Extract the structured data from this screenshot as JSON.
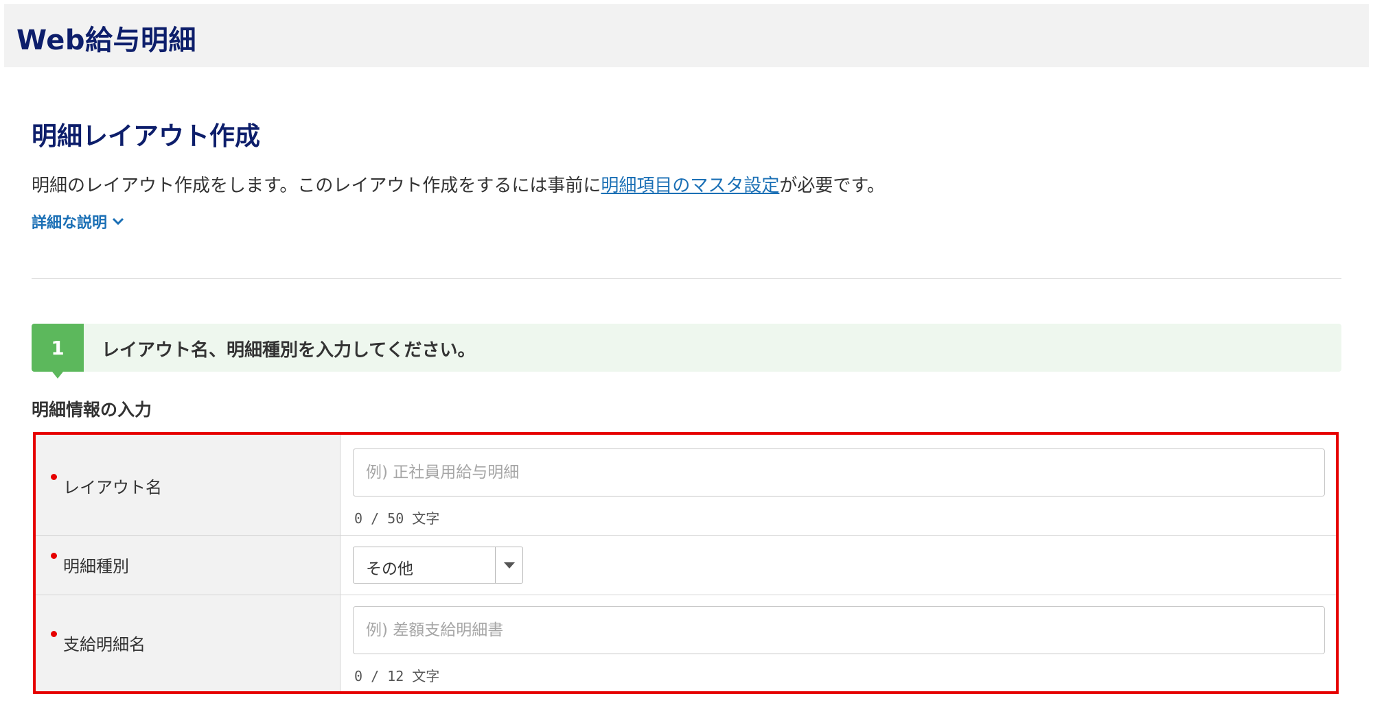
{
  "app": {
    "title": "Web給与明細"
  },
  "page": {
    "title": "明細レイアウト作成",
    "description_before": "明細のレイアウト作成をします。このレイアウト作成をするには事前に",
    "description_link": "明細項目のマスタ設定",
    "description_after": "が必要です。",
    "detail_toggle": "詳細な説明",
    "detail_icon": "chevron-down-icon"
  },
  "step": {
    "number": "1",
    "text": "レイアウト名、明細種別を入力してください。"
  },
  "section": {
    "title": "明細情報の入力"
  },
  "form": {
    "layout_name": {
      "label": "レイアウト名",
      "placeholder": "例) 正社員用給与明細",
      "value": "",
      "counter": "0 / 50 文字",
      "required": true
    },
    "detail_type": {
      "label": "明細種別",
      "selected": "その他",
      "required": true
    },
    "payment_name": {
      "label": "支給明細名",
      "placeholder": "例) 差額支給明細書",
      "value": "",
      "counter": "0 / 12 文字",
      "required": true
    }
  },
  "colors": {
    "brand_navy": "#0d1e6b",
    "link_blue": "#1a6fb5",
    "step_green": "#5cb85c",
    "required_red": "#e60000",
    "highlight_frame": "#e60000"
  }
}
